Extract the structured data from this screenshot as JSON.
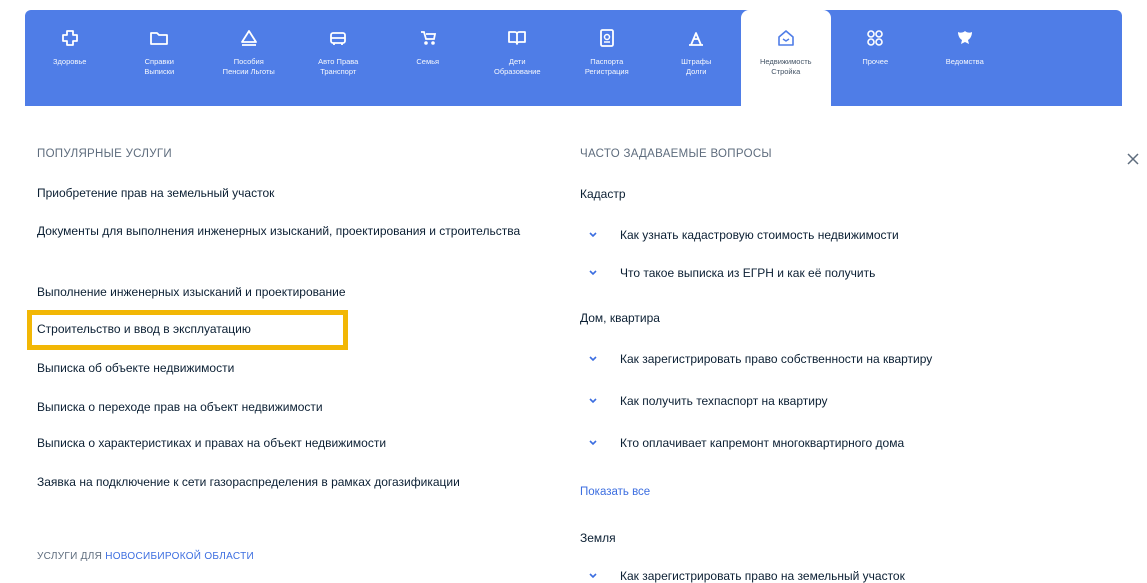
{
  "categories": [
    {
      "label": "Здоровье",
      "icon": "health-icon",
      "active": false
    },
    {
      "label": "Справки\nВыписки",
      "icon": "folder-icon",
      "active": false
    },
    {
      "label": "Пособия\nПенсии Льготы",
      "icon": "benefits-icon",
      "active": false
    },
    {
      "label": "Авто Права\nТранспорт",
      "icon": "car-icon",
      "active": false
    },
    {
      "label": "Семья",
      "icon": "stroller-icon",
      "active": false
    },
    {
      "label": "Дети\nОбразование",
      "icon": "book-icon",
      "active": false
    },
    {
      "label": "Паспорта\nРегистрация",
      "icon": "passport-icon",
      "active": false
    },
    {
      "label": "Штрафы\nДолги",
      "icon": "fine-icon",
      "active": false
    },
    {
      "label": "Недвижимость\nСтройка",
      "icon": "house-icon",
      "active": true
    },
    {
      "label": "Прочее",
      "icon": "grid-icon",
      "active": false
    },
    {
      "label": "Ведомства",
      "icon": "emblem-icon",
      "active": false
    }
  ],
  "popular": {
    "title": "ПОПУЛЯРНЫЕ УСЛУГИ",
    "items": [
      "Приобретение прав на земельный участок",
      "Документы для выполнения инженерных изысканий, проектирования и строительства",
      "Выполнение инженерных изысканий и проектирование",
      "Строительство и ввод в эксплуатацию",
      "Выписка об объекте недвижимости",
      "Выписка о переходе прав на объект недвижимости",
      "Выписка о характеристиках и правах на объект недвижимости",
      "Заявка на подключение к сети газораспределения в рамках догазификации"
    ],
    "region_prefix": "УСЛУГИ ДЛЯ ",
    "region_link": "НОВОСИБИРОКОЙ ОБЛАСТИ"
  },
  "faq": {
    "title": "ЧАСТО ЗАДАВАЕМЫЕ ВОПРОСЫ",
    "groups": [
      {
        "name": "Кадастр",
        "questions": [
          "Как узнать кадастровую стоимость недвижимости",
          "Что такое выписка из ЕГРН и как её получить"
        ]
      },
      {
        "name": "Дом, квартира",
        "questions": [
          "Как зарегистрировать право собственности на квартиру",
          "Как получить техпаспорт на квартиру",
          "Кто оплачивает капремонт многоквартирного дома"
        ]
      },
      {
        "name": "Земля",
        "questions": [
          "Как зарегистрировать право на земельный участок"
        ]
      }
    ],
    "show_all": "Показать все"
  },
  "colors": {
    "bar": "#4f7de7",
    "highlight": "#f2b705",
    "link": "#3c6ee0"
  }
}
